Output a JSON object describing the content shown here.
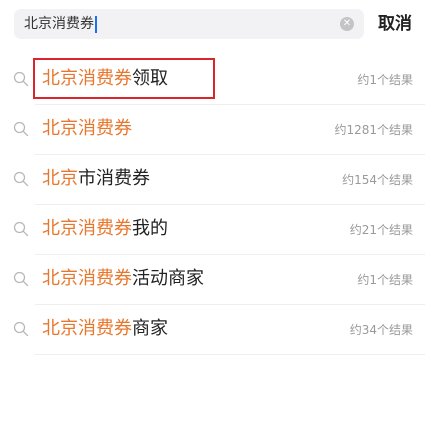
{
  "search": {
    "value": "北京消费券",
    "clear_icon": "clear-icon",
    "cancel_label": "取消"
  },
  "suggestions": [
    {
      "highlight": "北京消费券",
      "rest": "领取",
      "count": "约1个结果",
      "selected": true
    },
    {
      "highlight": "北京消费券",
      "rest": "",
      "count": "约1281个结果",
      "selected": false
    },
    {
      "highlight": "北京",
      "rest": "市消费券",
      "count": "约154个结果",
      "selected": false
    },
    {
      "highlight": "北京消费券",
      "rest": "我的",
      "count": "约21个结果",
      "selected": false
    },
    {
      "highlight": "北京消费券",
      "rest": "活动商家",
      "count": "约1个结果",
      "selected": false
    },
    {
      "highlight": "北京消费券",
      "rest": "商家",
      "count": "约34个结果",
      "selected": false
    }
  ],
  "colors": {
    "highlight_text": "#e8772e",
    "selection_border": "#d9262c",
    "caret": "#1d6ff2"
  }
}
